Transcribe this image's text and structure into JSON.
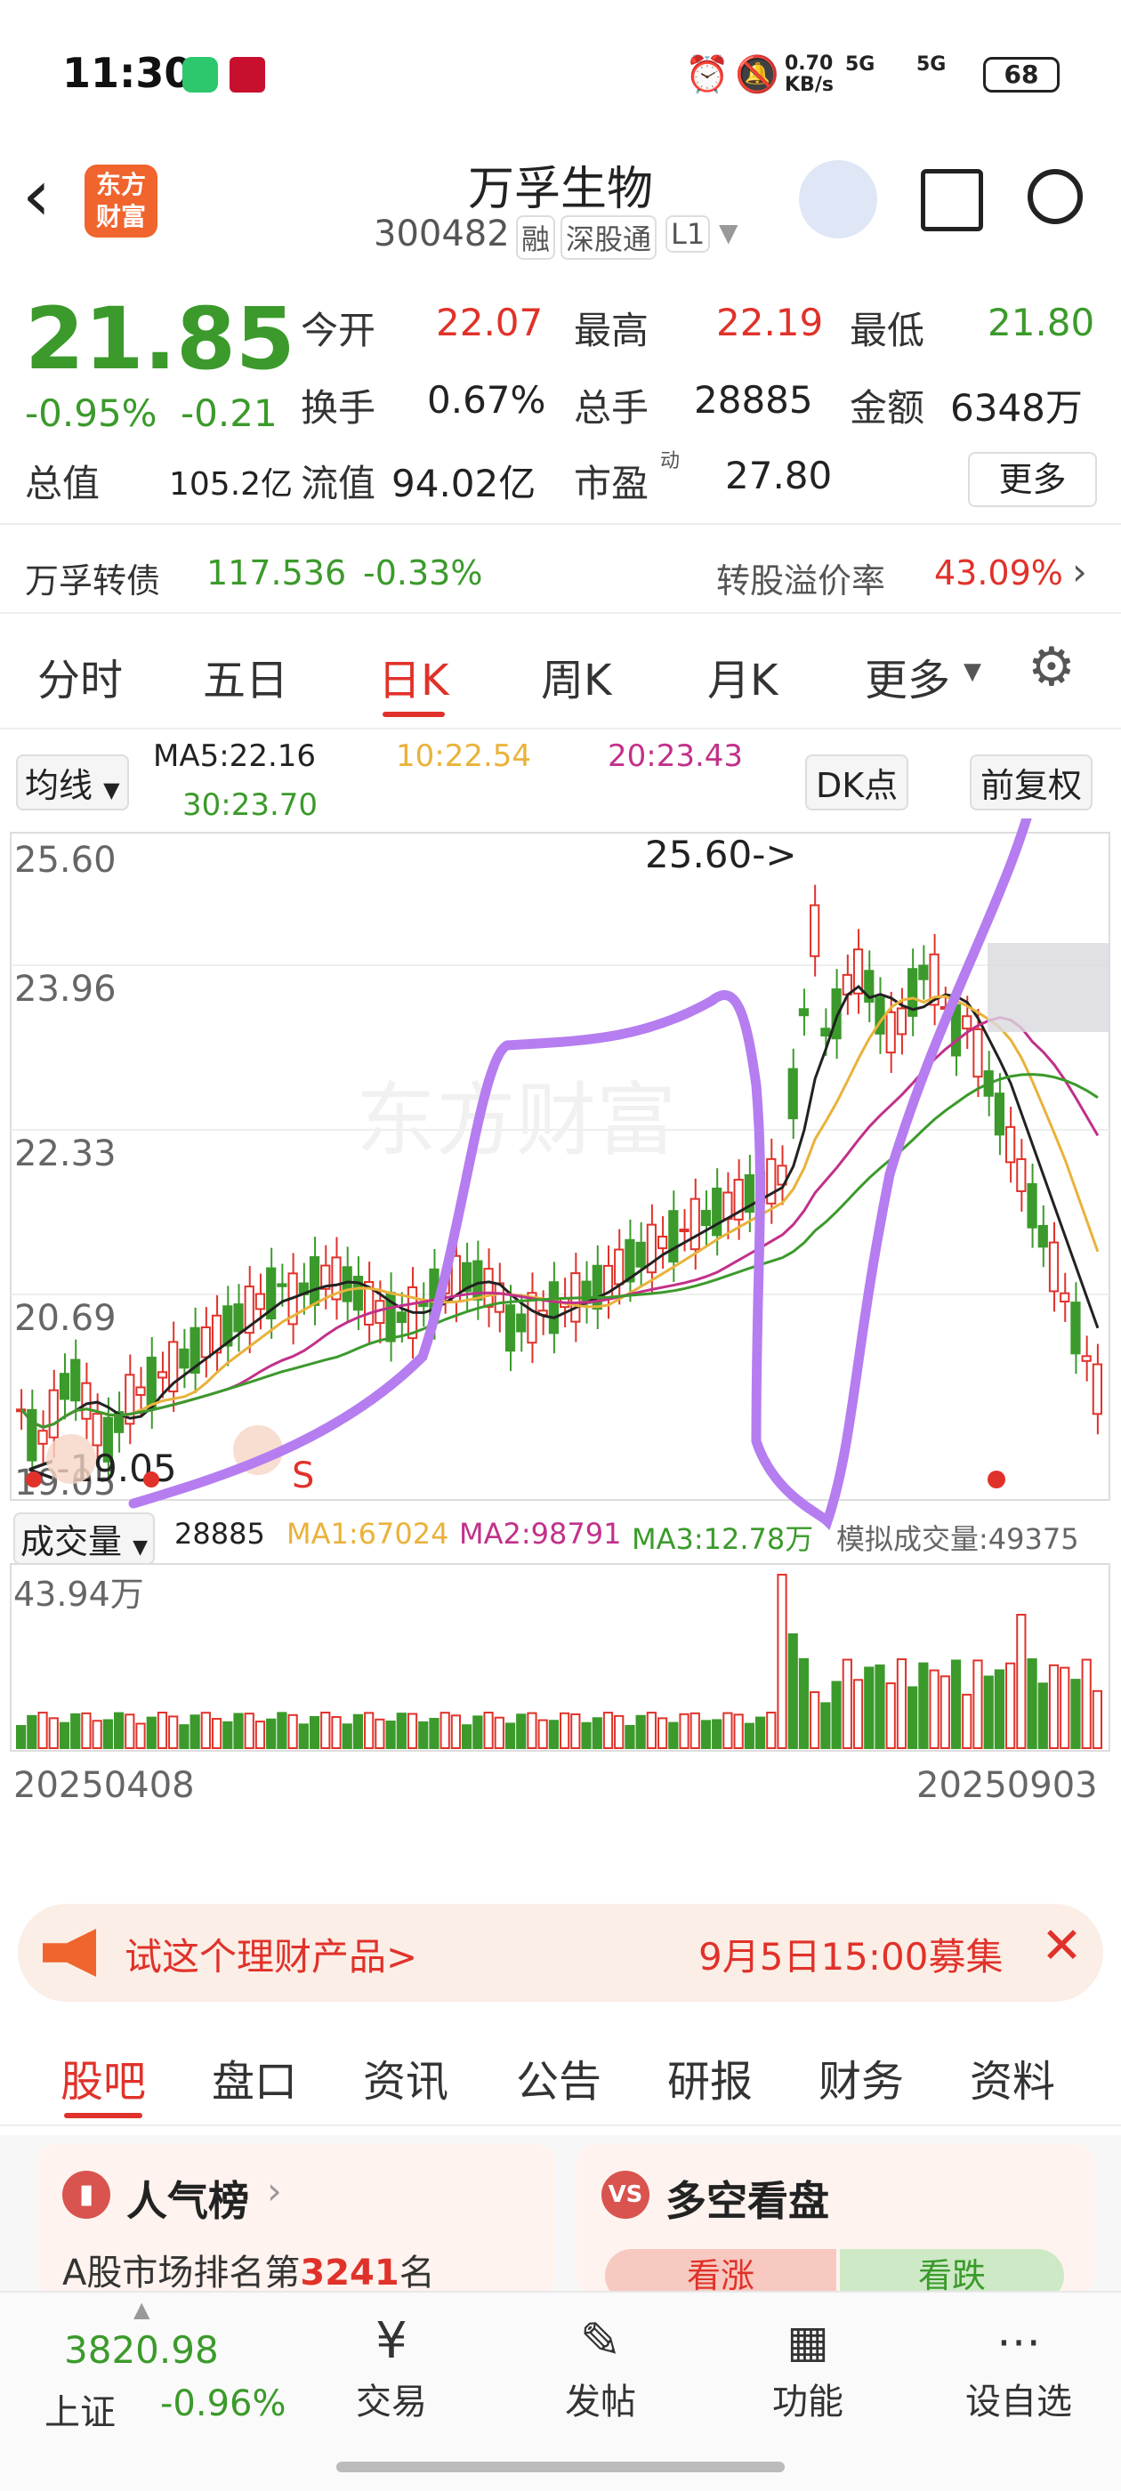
{
  "status": {
    "time": "11:30",
    "net_speed_top": "0.70",
    "net_speed_unit": "KB/s",
    "sig1": "5G",
    "sig2": "5G",
    "battery": "68"
  },
  "header": {
    "logo_line1": "东方",
    "logo_line2": "财富",
    "stock_name": "万孚生物",
    "stock_code": "300482",
    "tag_rong": "融",
    "tag_sgt": "深股通",
    "tag_l1": "L1"
  },
  "quote": {
    "price": "21.85",
    "change_pct": "-0.95%",
    "change_amt": "-0.21",
    "open_label": "今开",
    "open": "22.07",
    "high_label": "最高",
    "high": "22.19",
    "low_label": "最低",
    "low": "21.80",
    "turnover_label": "换手",
    "turnover": "0.67%",
    "volume_label": "总手",
    "volume": "28885",
    "amount_label": "金额",
    "amount": "6348万",
    "mcap_label": "总值",
    "mcap": "105.2亿",
    "float_label": "流值",
    "float_cap": "94.02亿",
    "pe_label": "市盈",
    "pe_sup": "动",
    "pe": "27.80",
    "more": "更多"
  },
  "convertible": {
    "name": "万孚转债",
    "price": "117.536",
    "change": "-0.33%",
    "premium_label": "转股溢价率",
    "premium": "43.09%"
  },
  "tabs": [
    "分时",
    "五日",
    "日K",
    "周K",
    "月K",
    "更多"
  ],
  "active_tab": "日K",
  "ma": {
    "toggle": "均线",
    "ma5": "MA5:22.16",
    "ma10": "10:22.54",
    "ma20": "20:23.43",
    "ma30": "30:23.70",
    "dk": "DK点",
    "fq": "前复权"
  },
  "chart_data": {
    "type": "candlestick",
    "y_ticks": [
      "25.60",
      "23.96",
      "22.33",
      "20.69",
      "19.05"
    ],
    "high_marker": "25.60->",
    "low_marker": "<-19.05",
    "x_start": "20250408",
    "x_end": "20250903",
    "vol_label": "成交量",
    "vol": "28885",
    "vol_ma1": "MA1:67024",
    "vol_ma2": "MA2:98791",
    "vol_ma3": "MA3:12.78万",
    "sim_vol": "模拟成交量:49375",
    "vol_max": "43.94万",
    "s_mark": "S"
  },
  "banner": {
    "text": "试这个理财产品>",
    "time": "9月5日15:00募集"
  },
  "content_tabs": [
    "股吧",
    "盘口",
    "资讯",
    "公告",
    "研报",
    "财务",
    "资料"
  ],
  "cards": {
    "rank_title": "人气榜",
    "rank_text_pre": "A股市场排名第",
    "rank_num": "3241",
    "rank_text_post": "名",
    "vs_title": "多空看盘",
    "bull": "看涨",
    "bear": "看跌"
  },
  "bottom": {
    "index_val": "3820.98",
    "index_name": "上证",
    "index_chg": "-0.96%",
    "trade": "交易",
    "post": "发帖",
    "func": "功能",
    "watch": "设自选"
  }
}
